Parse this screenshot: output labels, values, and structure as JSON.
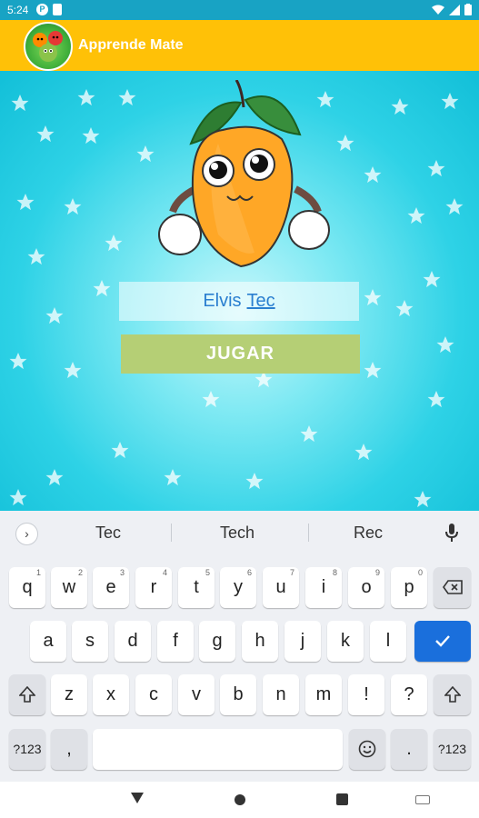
{
  "status_bar": {
    "time": "5:24",
    "icons": [
      "notification-icon",
      "sim-card-icon",
      "wifi-icon",
      "signal-icon",
      "battery-icon"
    ]
  },
  "app_bar": {
    "title": "Apprende Mate",
    "logo_icon": "fruit-characters-logo"
  },
  "main": {
    "mascot": "mango-character",
    "name_field": {
      "text": "Elvis",
      "composing_word": "Tec"
    },
    "play_button": "JUGAR",
    "colors": {
      "background_center": "#c8f7fb",
      "background_edge": "#12bfd8",
      "button": "#b5cf75"
    }
  },
  "keyboard": {
    "suggestions": [
      "Tec",
      "Tech",
      "Rec"
    ],
    "row1": [
      {
        "label": "q",
        "hint": "1"
      },
      {
        "label": "w",
        "hint": "2"
      },
      {
        "label": "e",
        "hint": "3"
      },
      {
        "label": "r",
        "hint": "4"
      },
      {
        "label": "t",
        "hint": "5"
      },
      {
        "label": "y",
        "hint": "6"
      },
      {
        "label": "u",
        "hint": "7"
      },
      {
        "label": "i",
        "hint": "8"
      },
      {
        "label": "o",
        "hint": "9"
      },
      {
        "label": "p",
        "hint": "0"
      }
    ],
    "row2": [
      "a",
      "s",
      "d",
      "f",
      "g",
      "h",
      "j",
      "k",
      "l"
    ],
    "row3": [
      "z",
      "x",
      "c",
      "v",
      "b",
      "n",
      "m",
      "!",
      "?"
    ],
    "row4": {
      "symbols": "?123",
      "comma": ",",
      "period": "."
    },
    "icons": [
      "chevron-right-icon",
      "mic-icon",
      "backspace-icon",
      "checkmark-icon",
      "shift-icon",
      "emoji-icon"
    ],
    "enter_color": "#1a6fdc"
  }
}
